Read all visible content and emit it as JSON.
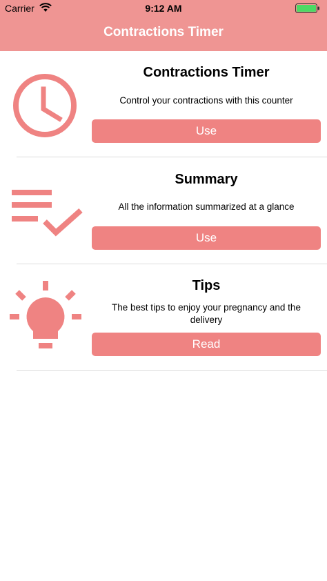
{
  "status_bar": {
    "carrier": "Carrier",
    "time": "9:12 AM"
  },
  "nav": {
    "title": "Contractions Timer"
  },
  "sections": [
    {
      "icon": "clock-icon",
      "title": "Contractions Timer",
      "description": "Control your contractions with this counter",
      "button": "Use"
    },
    {
      "icon": "checklist-icon",
      "title": "Summary",
      "description": "All the information summarized at a glance",
      "button": "Use"
    },
    {
      "icon": "lightbulb-icon",
      "title": "Tips",
      "description": "The best tips to enjoy your pregnancy and the delivery",
      "button": "Read"
    }
  ],
  "colors": {
    "header": "#ef9593",
    "accent": "#ef8382",
    "icon": "#ef8382"
  }
}
